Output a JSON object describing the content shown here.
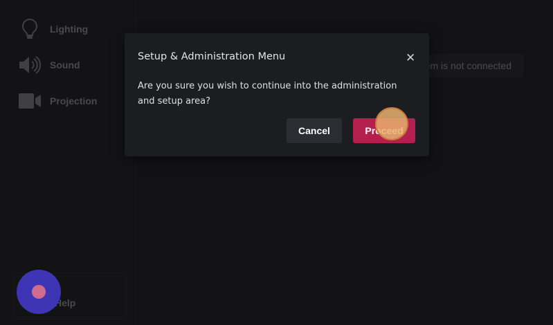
{
  "sidebar": {
    "items": [
      {
        "label": "Lighting",
        "icon": "lightbulb-icon"
      },
      {
        "label": "Sound",
        "icon": "speaker-icon"
      },
      {
        "label": "Projection",
        "icon": "video-camera-icon"
      }
    ],
    "help_label": "Help"
  },
  "status": {
    "text": "System is not connected"
  },
  "modal": {
    "title": "Setup & Administration Menu",
    "message": "Are you sure you wish to continue into the administration and setup area?",
    "cancel_label": "Cancel",
    "proceed_label": "Proceed"
  },
  "colors": {
    "accent": "#b3204f",
    "record_button": "#3d35b4",
    "background": "#121215"
  }
}
